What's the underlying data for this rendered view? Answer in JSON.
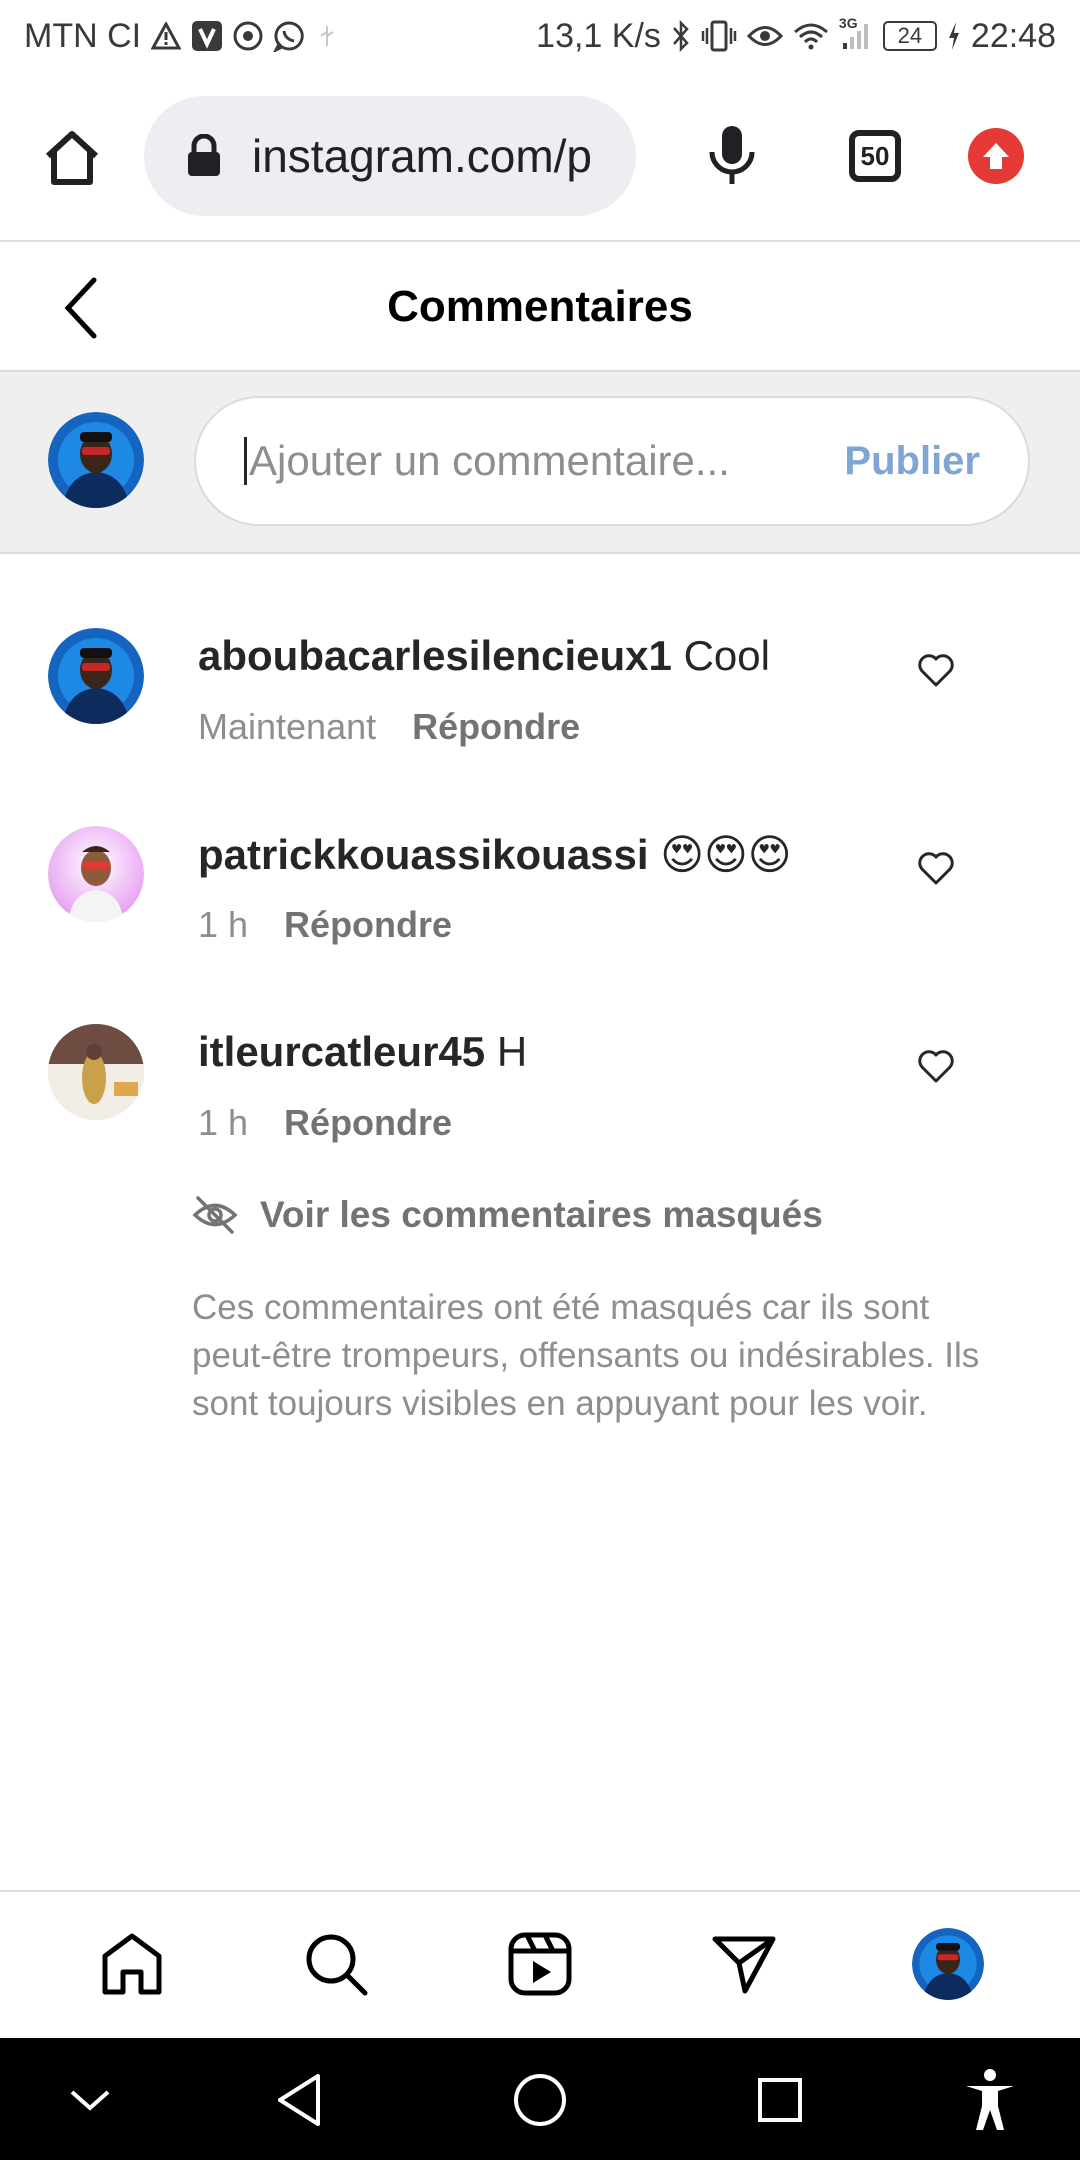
{
  "status_bar": {
    "carrier": "MTN CI",
    "speed": "13,1 K/s",
    "network": "3G",
    "battery": "24",
    "time": "22:48"
  },
  "browser": {
    "url": "instagram.com/p",
    "tab_count": "50",
    "accent_color": "#e53935"
  },
  "header": {
    "title": "Commentaires"
  },
  "composer": {
    "placeholder": "Ajouter un commentaire...",
    "value": "",
    "publish_label": "Publier"
  },
  "comments": [
    {
      "username": "aboubacarlesilencieux1",
      "text": "Cool",
      "time": "Maintenant",
      "reply_label": "Répondre"
    },
    {
      "username": "patrickkouassikouassi",
      "text": "😍😍😍",
      "time": "1 h",
      "reply_label": "Répondre"
    },
    {
      "username": "itleurcatleur45",
      "text": "H",
      "time": "1 h",
      "reply_label": "Répondre"
    }
  ],
  "hidden_comments": {
    "label": "Voir les commentaires masqués",
    "note": "Ces commentaires ont été masqués car ils sont peut-être trompeurs, offensants ou indésirables. Ils sont toujours visibles en appuyant pour les voir."
  },
  "icons": {
    "status": [
      "warning-icon",
      "v-app-icon",
      "chrome-icon",
      "whatsapp-icon",
      "bluetooth-icon",
      "vibrate-icon",
      "eye-icon",
      "wifi-icon",
      "signal-icon",
      "charging-icon"
    ],
    "bottom_nav": [
      "home-icon",
      "search-icon",
      "reels-icon",
      "direct-icon",
      "profile-avatar"
    ],
    "system_nav": [
      "collapse-icon",
      "back-icon",
      "home-circle-icon",
      "recents-icon",
      "accessibility-icon"
    ]
  }
}
